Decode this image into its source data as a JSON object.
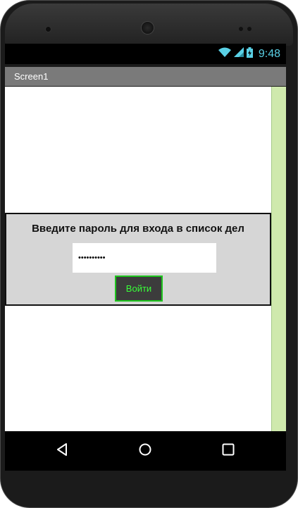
{
  "status_bar": {
    "time": "9:48",
    "icons": [
      "wifi-icon",
      "signal-icon",
      "battery-icon"
    ]
  },
  "app": {
    "screen_title": "Screen1"
  },
  "login": {
    "prompt": "Введите пароль для входа в список дел",
    "password_value": "••••••••••",
    "button_label": "Войти"
  },
  "nav": {
    "buttons": [
      "back-icon",
      "home-icon",
      "recents-icon"
    ]
  },
  "colors": {
    "accent_strip": "#cfe9ad",
    "button_text": "#39ff39",
    "button_border": "#1ec51e",
    "clock": "#5ad1e6"
  }
}
